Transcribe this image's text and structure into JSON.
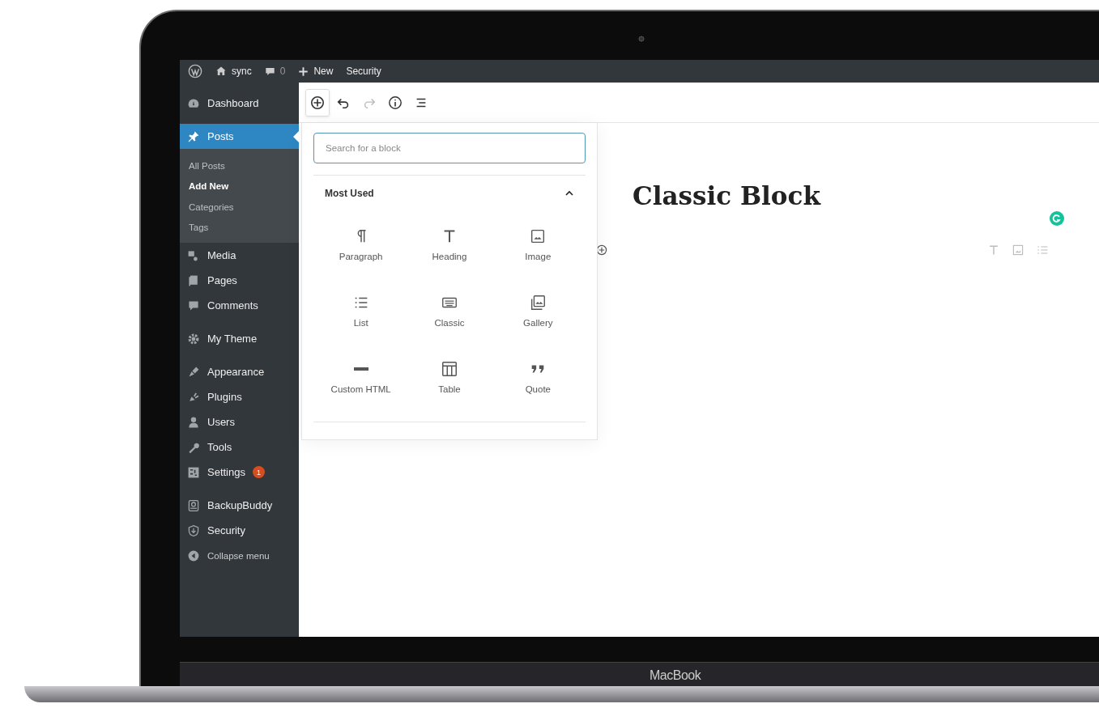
{
  "admin_bar": {
    "site": "sync",
    "comments": "0",
    "new": "New",
    "security": "Security"
  },
  "sidebar": {
    "items": [
      {
        "label": "Dashboard",
        "selected": false
      },
      {
        "label": "Posts",
        "selected": true,
        "children": [
          {
            "label": "All Posts",
            "selected": false
          },
          {
            "label": "Add New",
            "selected": true
          },
          {
            "label": "Categories",
            "selected": false
          },
          {
            "label": "Tags",
            "selected": false
          }
        ]
      },
      {
        "label": "Media",
        "selected": false
      },
      {
        "label": "Pages",
        "selected": false
      },
      {
        "label": "Comments",
        "selected": false
      },
      {
        "label": "My Theme",
        "selected": false
      },
      {
        "label": "Appearance",
        "selected": false
      },
      {
        "label": "Plugins",
        "selected": false
      },
      {
        "label": "Users",
        "selected": false
      },
      {
        "label": "Tools",
        "selected": false
      },
      {
        "label": "Settings",
        "selected": false,
        "badge": "1"
      },
      {
        "label": "BackupBuddy",
        "selected": false
      },
      {
        "label": "Security",
        "selected": false
      },
      {
        "label": "Collapse menu",
        "selected": false
      }
    ]
  },
  "toolbar": {
    "inserter_open": true
  },
  "inserter": {
    "search": {
      "placeholder": "Search for a block"
    },
    "category": "Most Used",
    "expanded": true,
    "blocks": [
      {
        "label": "Paragraph"
      },
      {
        "label": "Heading"
      },
      {
        "label": "Image"
      },
      {
        "label": "List"
      },
      {
        "label": "Classic"
      },
      {
        "label": "Gallery"
      },
      {
        "label": "Custom HTML"
      },
      {
        "label": "Table"
      },
      {
        "label": "Quote"
      }
    ]
  },
  "editor": {
    "title": "Classic Block"
  },
  "device_label": "MacBook"
}
